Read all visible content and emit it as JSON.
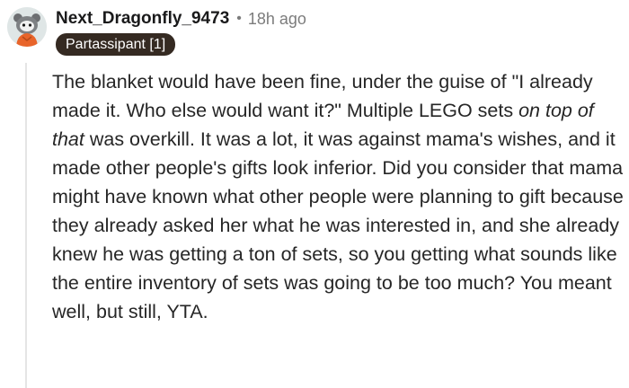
{
  "comment": {
    "author": "Next_Dragonfly_9473",
    "separator": "•",
    "time_ago": "18h ago",
    "flair": "Partassipant [1]",
    "avatar_icon": "snoo-avatar-icon",
    "body": {
      "part1": "The blanket would have been fine, under the guise of \"I already made it. Who else would want it?\" Multiple LEGO sets ",
      "emphasis": "on top of that",
      "part2": " was overkill. It was a lot, it was against mama's wishes, and it made other people's gifts look inferior. Did you consider that mama might have known what other people were planning to gift because they already asked her what he was interested in, and she already knew he was getting a ton of sets, so you getting what sounds like the entire inventory of sets was going to be too much? You meant well, but still, YTA."
    }
  },
  "colors": {
    "flair_background": "#352a22",
    "flair_text": "#ffffff",
    "meta_gray": "#7c7c7c",
    "thread_line": "#e5e5e5",
    "text": "#262626"
  }
}
